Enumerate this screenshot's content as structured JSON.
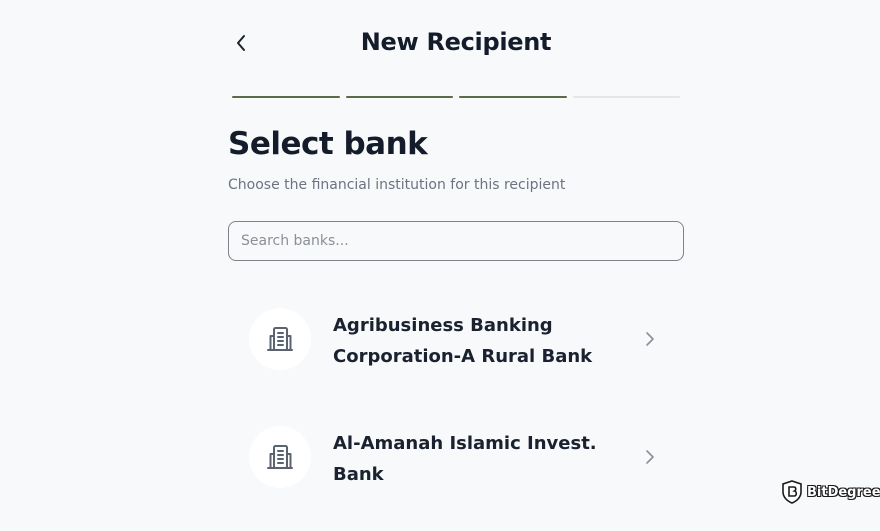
{
  "header": {
    "back_icon": "chevron-left-icon",
    "title": "New Recipient"
  },
  "progress": {
    "total_steps": 4,
    "completed_steps": 3,
    "complete_color": "#5b6b45",
    "pending_color": "#e4e6ea"
  },
  "content": {
    "heading": "Select bank",
    "subtitle": "Choose the financial institution for this recipient"
  },
  "search": {
    "placeholder": "Search banks...",
    "value": ""
  },
  "banks": [
    {
      "name": "Agribusiness Banking Corporation-A Rural Bank",
      "icon": "bank-building-icon"
    },
    {
      "name": "Al-Amanah Islamic Invest. Bank",
      "icon": "bank-building-icon"
    }
  ],
  "watermark": {
    "text": "BitDegree",
    "icon": "bitdegree-logo-icon"
  },
  "colors": {
    "background": "#f8f9fb",
    "text_primary": "#141c2b",
    "text_secondary": "#6c7380",
    "icon": "#5c6370"
  }
}
